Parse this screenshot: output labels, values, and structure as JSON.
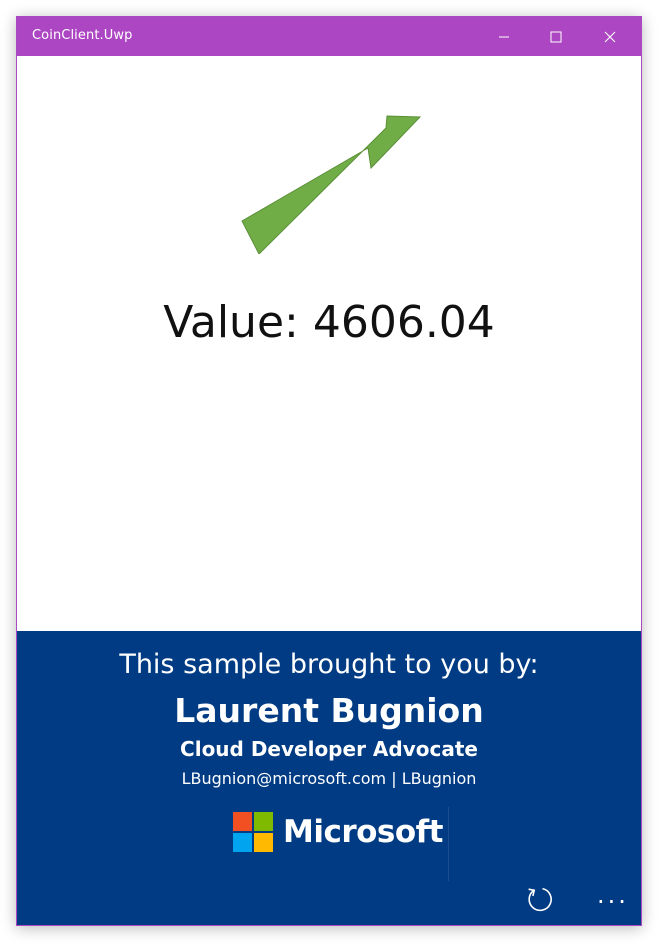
{
  "window": {
    "title": "CoinClient.Uwp"
  },
  "titlebar_buttons": {
    "minimize_icon": "minimize-icon",
    "maximize_icon": "maximize-icon",
    "close_icon": "close-icon"
  },
  "main": {
    "trend_icon": "trend-up-arrow-icon",
    "value_label": "Value:",
    "value": "4606.04"
  },
  "footer": {
    "brought_by": "This sample brought to you by:",
    "author_name": "Laurent Bugnion",
    "author_role": "Cloud Developer Advocate",
    "author_contact": "LBugnion@microsoft.com | LBugnion",
    "company_logo_text": "Microsoft"
  },
  "appbar": {
    "refresh_icon": "refresh-icon",
    "more_icon": "more-icon",
    "more_label": "..."
  },
  "colors": {
    "titlebar": "#ad46c2",
    "footer_background": "#003b83",
    "arrow_fill": "#70ad47",
    "logo_red": "#f25022",
    "logo_green": "#7fba00",
    "logo_blue": "#00a4ef",
    "logo_yellow": "#ffb900"
  }
}
